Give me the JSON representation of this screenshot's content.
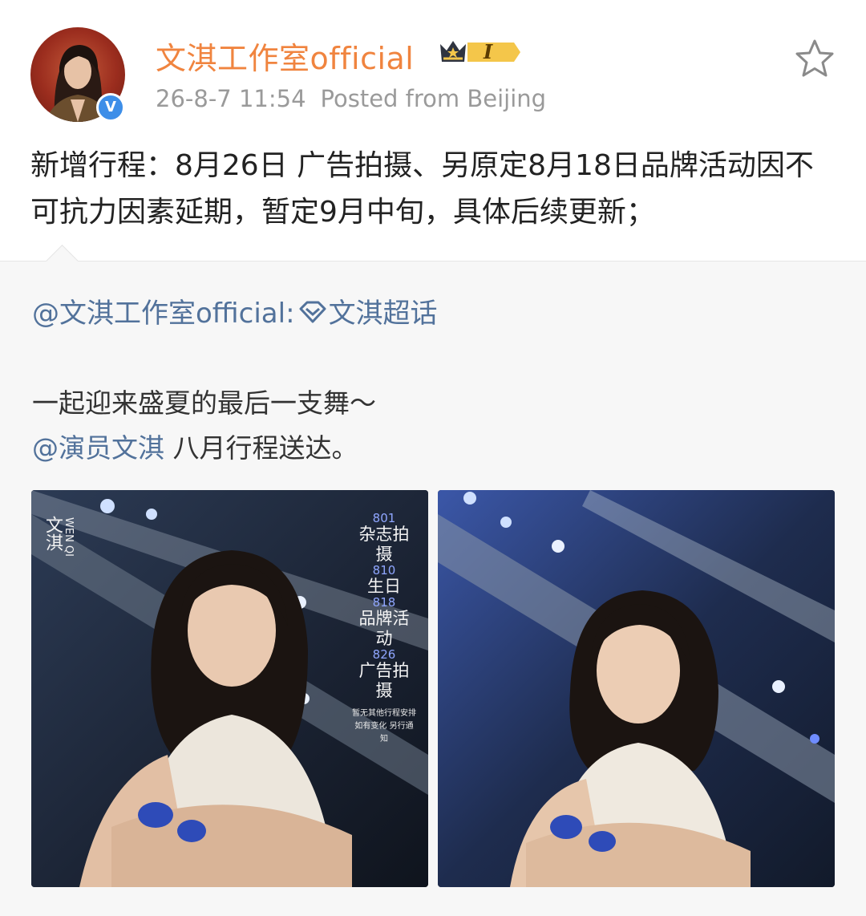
{
  "post": {
    "username": "文淇工作室official",
    "vip_level": "I",
    "timestamp": "26-8-7 11:54",
    "location": "Posted from Beijing",
    "text": "新增行程：8月26日 广告拍摄、另原定8月18日品牌活动因不可抗力因素延期，暂定9月中旬，具体后续更新；",
    "verified_mark": "V"
  },
  "repost": {
    "author_mention": "@文淇工作室official:",
    "topic": "文淇超话",
    "line1": "一起迎来盛夏的最后一支舞～",
    "mention2": "@演员文淇",
    "line2": " 八月行程送达。"
  },
  "photo1_overlay": {
    "name_cn": "文淇",
    "name_en": "WEN QI",
    "schedule": [
      {
        "date": "801",
        "event": "杂志拍摄"
      },
      {
        "date": "810",
        "event": "生日"
      },
      {
        "date": "818",
        "event": "品牌活动"
      },
      {
        "date": "826",
        "event": "广告拍摄"
      }
    ],
    "note1": "暂无其他行程安排",
    "note2": "如有变化 另行通知"
  },
  "icons": {
    "star": "favorite-star-icon",
    "verified": "verified-badge-icon",
    "crown": "vip-crown-icon",
    "topic": "super-topic-diamond-icon"
  },
  "colors": {
    "username": "#f0843f",
    "link": "#52729b",
    "verified": "#3d8ee8",
    "repost_bg": "#f7f7f7"
  }
}
